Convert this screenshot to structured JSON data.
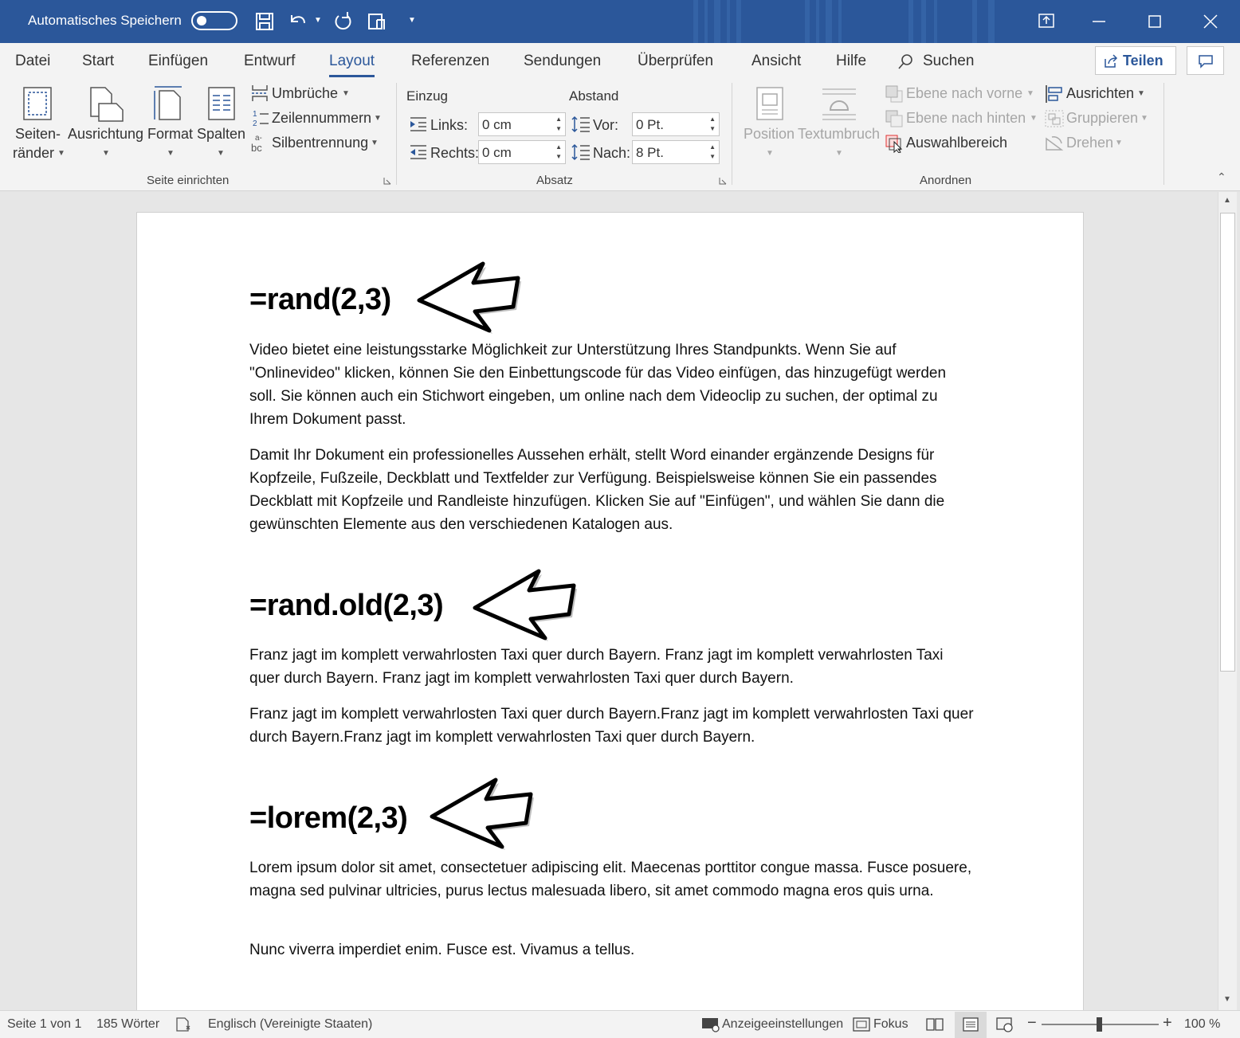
{
  "titlebar": {
    "autosave_label": "Automatisches Speichern",
    "autosave_state": "off",
    "bg_color": "#2b579a",
    "quick_access_icons": [
      "save-icon",
      "undo-icon",
      "redo-icon",
      "touch-mode-icon",
      "customize-icon"
    ],
    "window_buttons": [
      "ribbon-display-icon",
      "minimize-icon",
      "maximize-icon",
      "close-icon"
    ]
  },
  "tabs": {
    "items": [
      "Datei",
      "Start",
      "Einfügen",
      "Entwurf",
      "Layout",
      "Referenzen",
      "Sendungen",
      "Überprüfen",
      "Ansicht",
      "Hilfe"
    ],
    "active": "Layout",
    "search_label": "Suchen",
    "share_label": "Teilen"
  },
  "ribbon": {
    "page_setup": {
      "group_label": "Seite einrichten",
      "margins_line1": "Seiten-",
      "margins_line2": "ränder",
      "orientation": "Ausrichtung",
      "size": "Format",
      "columns": "Spalten",
      "breaks": "Umbrüche",
      "line_numbers": "Zeilennummern",
      "hyphenation": "Silbentrennung"
    },
    "paragraph": {
      "group_label": "Absatz",
      "indent_header": "Einzug",
      "spacing_header": "Abstand",
      "left_label": "Links:",
      "left_value": "0 cm",
      "right_label": "Rechts:",
      "right_value": "0 cm",
      "before_label": "Vor:",
      "before_value": "0 Pt.",
      "after_label": "Nach:",
      "after_value": "8 Pt."
    },
    "arrange": {
      "group_label": "Anordnen",
      "position": "Position",
      "wrap_text": "Textumbruch",
      "bring_forward": "Ebene nach vorne",
      "send_backward": "Ebene nach hinten",
      "selection_pane": "Auswahlbereich",
      "align": "Ausrichten",
      "group": "Gruppieren",
      "rotate": "Drehen"
    }
  },
  "document": {
    "sections": [
      {
        "heading": "=rand(2,3)",
        "paragraphs": [
          "Video bietet eine leistungsstarke Möglichkeit zur Unterstützung Ihres Standpunkts. Wenn Sie auf \"Onlinevideo\" klicken, können Sie den Einbettungscode für das Video einfügen, das hinzugefügt werden soll. Sie können auch ein Stichwort eingeben, um online nach dem Videoclip zu suchen, der optimal zu Ihrem Dokument passt.",
          "Damit Ihr Dokument ein professionelles Aussehen erhält, stellt Word einander ergänzende Designs für Kopfzeile, Fußzeile, Deckblatt und Textfelder zur Verfügung. Beispielsweise können Sie ein passendes Deckblatt mit Kopfzeile und Randleiste hinzufügen. Klicken Sie auf \"Einfügen\", und wählen Sie dann die gewünschten Elemente aus den verschiedenen Katalogen aus."
        ]
      },
      {
        "heading": "=rand.old(2,3)",
        "paragraphs": [
          "Franz jagt im komplett verwahrlosten Taxi quer durch Bayern. Franz jagt im komplett verwahrlosten Taxi quer durch Bayern. Franz jagt im komplett verwahrlosten Taxi quer durch Bayern.",
          "Franz jagt im komplett verwahrlosten Taxi quer durch Bayern.Franz jagt im komplett verwahrlosten Taxi quer durch Bayern.Franz jagt im komplett verwahrlosten Taxi quer durch Bayern."
        ]
      },
      {
        "heading": "=lorem(2,3)",
        "paragraphs": [
          "Lorem ipsum dolor sit amet, consectetuer adipiscing elit. Maecenas porttitor congue massa. Fusce posuere, magna sed pulvinar ultricies, purus lectus malesuada libero, sit amet commodo magna eros quis urna.",
          "Nunc viverra imperdiet enim. Fusce est. Vivamus a tellus."
        ]
      }
    ]
  },
  "statusbar": {
    "page": "Seite 1 von 1",
    "words": "185 Wörter",
    "language": "Englisch (Vereinigte Staaten)",
    "display_settings": "Anzeigeeinstellungen",
    "focus": "Fokus",
    "zoom_percent": "100 %",
    "zoom_value": 1.0
  }
}
